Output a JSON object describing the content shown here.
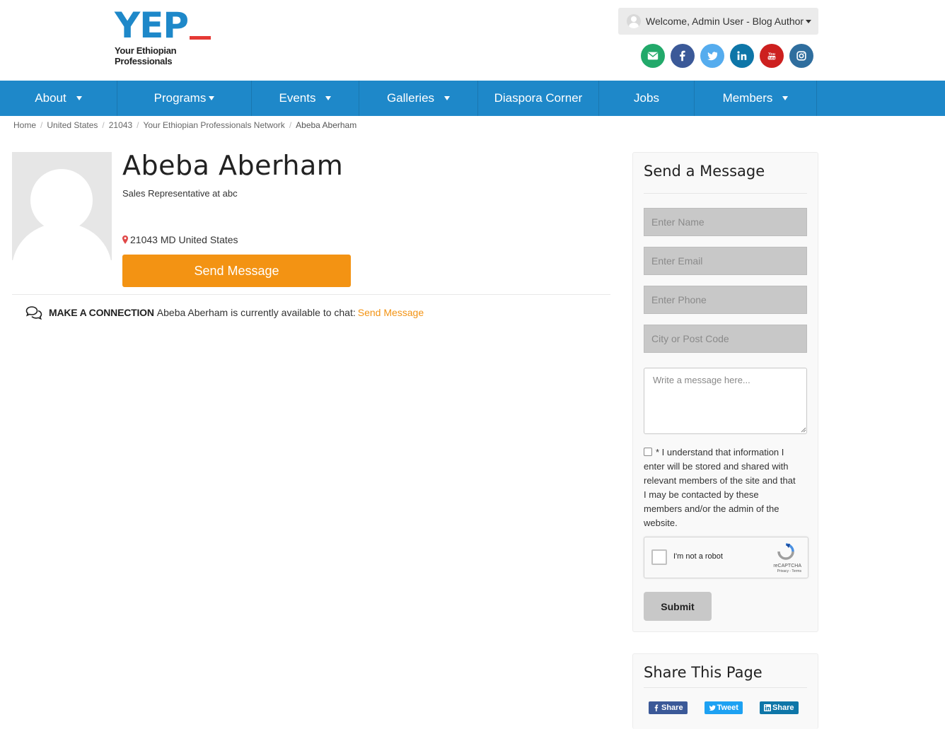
{
  "header": {
    "logo_mark": "YEP",
    "logo_tagline": "Your Ethiopian Professionals",
    "welcome_text": "Welcome, Admin User - Blog Author",
    "socials": [
      {
        "name": "email",
        "color": "#22a96a"
      },
      {
        "name": "facebook",
        "color": "#3b5998"
      },
      {
        "name": "twitter",
        "color": "#55acee"
      },
      {
        "name": "linkedin",
        "color": "#0e76a8"
      },
      {
        "name": "youtube",
        "color": "#cd201f"
      },
      {
        "name": "instagram",
        "color": "#2f6e9e"
      }
    ]
  },
  "nav": {
    "items": [
      {
        "label": "About",
        "has_menu": true
      },
      {
        "label": "Programs",
        "has_menu": true
      },
      {
        "label": "Events",
        "has_menu": true
      },
      {
        "label": "Galleries",
        "has_menu": true
      },
      {
        "label": "Diaspora Corner",
        "has_menu": false
      },
      {
        "label": "Jobs",
        "has_menu": false
      },
      {
        "label": "Members",
        "has_menu": true
      }
    ],
    "color": "#1e88c9"
  },
  "breadcrumb": [
    "Home",
    "United States",
    "21043",
    "Your Ethiopian Professionals Network",
    "Abeba Aberham"
  ],
  "profile": {
    "name": "Abeba Aberham",
    "title": "Sales Representative at abc",
    "location": "21043 MD United States",
    "send_button": "Send Message",
    "connect_heading": "MAKE A CONNECTION",
    "connect_text": "Abeba Aberham is currently available to chat:",
    "connect_link": "Send Message",
    "accent_color": "#f39313"
  },
  "message_panel": {
    "title": "Send a Message",
    "name_placeholder": "Enter Name",
    "email_placeholder": "Enter Email",
    "phone_placeholder": "Enter Phone",
    "city_placeholder": "City or Post Code",
    "message_placeholder": "Write a message here...",
    "consent_text": "* I understand that information I enter will be stored and shared with relevant members of the site and that I may be contacted by these members and/or the admin of the website.",
    "captcha_label": "I'm not a robot",
    "captcha_brand": "reCAPTCHA",
    "captcha_terms": "Privacy - Terms",
    "submit_label": "Submit"
  },
  "share_panel": {
    "title": "Share This Page",
    "buttons": [
      {
        "label": "Share",
        "network": "facebook",
        "color": "#3b5998"
      },
      {
        "label": "Tweet",
        "network": "twitter",
        "color": "#1da1f2"
      },
      {
        "label": "Share",
        "network": "linkedin",
        "color": "#0e76a8"
      }
    ]
  }
}
